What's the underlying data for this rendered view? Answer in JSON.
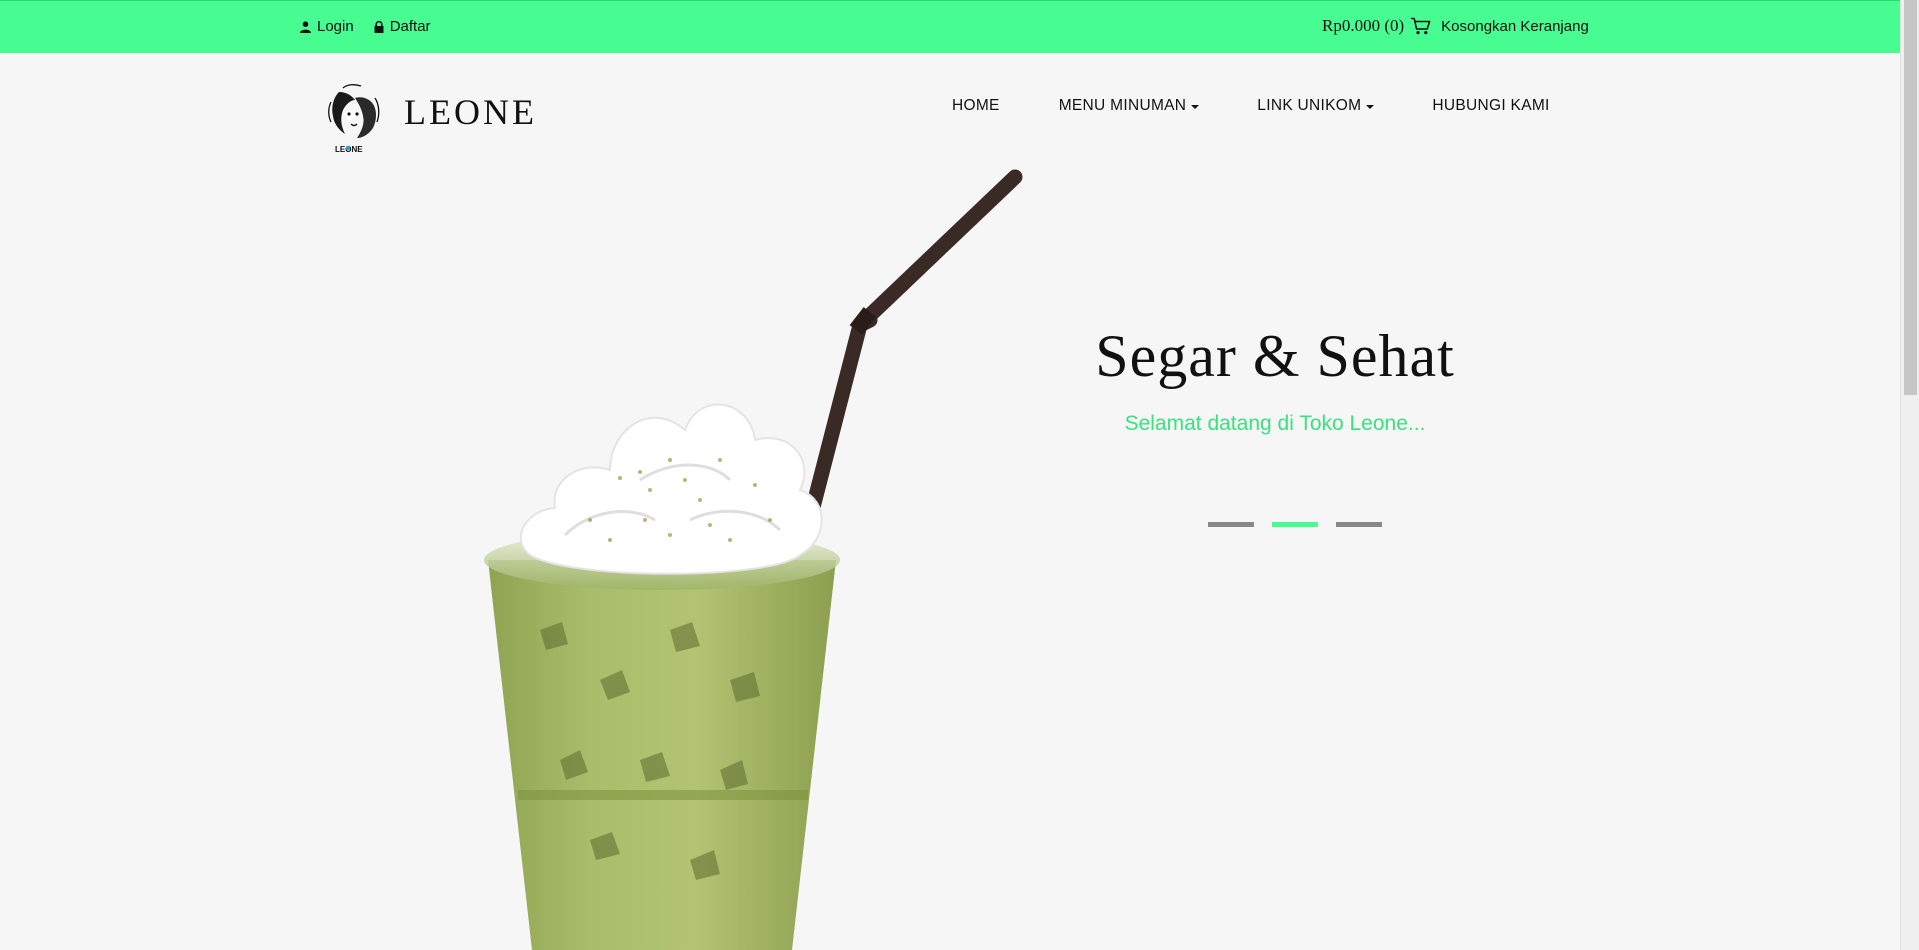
{
  "topbar": {
    "login_label": "Login",
    "register_label": "Daftar",
    "cart_total": "Rp0.000 (0)",
    "empty_cart_label": "Kosongkan Keranjang",
    "icons": {
      "login": "user-icon",
      "register": "lock-icon",
      "cart": "cart-icon"
    },
    "accent": "#47fd92"
  },
  "brand": {
    "name": "LEONE",
    "logo_caption": "LEONE"
  },
  "nav": {
    "home": "HOME",
    "menu_minuman": "MENU MINUMAN",
    "link_unikom": "LINK UNIKOM",
    "hubungi_kami": "HUBUNGI KAMI"
  },
  "hero": {
    "title": "Segar & Sehat",
    "subtitle": "Selamat datang di Toko Leone...",
    "slides_count": 3,
    "active_slide": 2,
    "subtitle_color": "#38e27f"
  }
}
